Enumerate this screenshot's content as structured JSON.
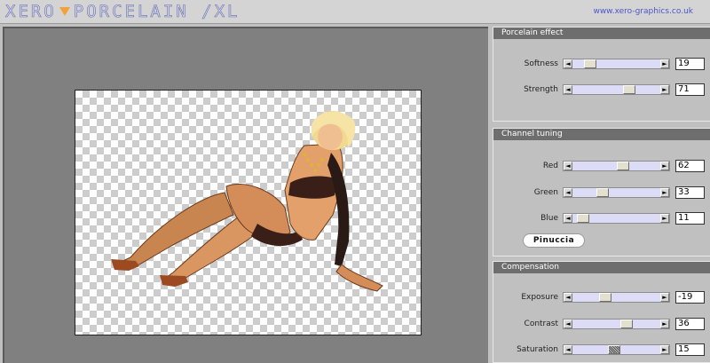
{
  "app": {
    "logo_left": "XERO",
    "logo_right": "PORCELAIN /XL",
    "website": "www.xero-graphics.co.uk"
  },
  "panels": [
    {
      "title": "Porcelain effect",
      "sliders": [
        {
          "label": "Softness",
          "value": "19",
          "fraction": 0.19
        },
        {
          "label": "Strength",
          "value": "71",
          "fraction": 0.71
        }
      ]
    },
    {
      "title": "Channel tuning",
      "sliders": [
        {
          "label": "Red",
          "value": "62",
          "fraction": 0.62
        },
        {
          "label": "Green",
          "value": "33",
          "fraction": 0.33
        },
        {
          "label": "Blue",
          "value": "11",
          "fraction": 0.11
        }
      ],
      "watermark": "Pinuccia"
    },
    {
      "title": "Compensation",
      "sliders": [
        {
          "label": "Exposure",
          "value": "-19",
          "fraction": 0.4
        },
        {
          "label": "Contrast",
          "value": "36",
          "fraction": 0.68
        },
        {
          "label": "Saturation",
          "value": "15",
          "fraction": 0.57
        }
      ]
    }
  ],
  "icons": {
    "left_arrow": "◄",
    "right_arrow": "►"
  }
}
